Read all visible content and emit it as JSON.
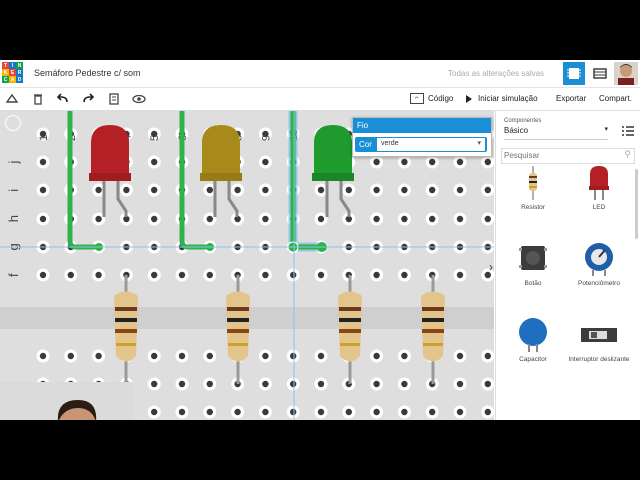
{
  "app": {
    "title": "Semáforo Pedestre c/ som",
    "saved_status": "Todas as alterações salvas"
  },
  "logo": {
    "letters": [
      "T",
      "I",
      "N",
      "K",
      "E",
      "R",
      "C",
      "A",
      "D"
    ],
    "colors": [
      "#e8453c",
      "#1478c8",
      "#12a14a",
      "#f7b500",
      "#e8453c",
      "#1478c8",
      "#12a14a",
      "#f7b500",
      "#1478c8"
    ]
  },
  "toolbar": {
    "code_label": "Código",
    "simulate_label": "Iniciar simulação",
    "export_label": "Exportar",
    "share_label": "Compart."
  },
  "breadboard": {
    "column_numbers": [
      "1",
      "2",
      "3",
      "4",
      "5",
      "6",
      "7",
      "8",
      "9",
      "10",
      "11"
    ],
    "row_letters": [
      "j",
      "i",
      "h",
      "g",
      "f"
    ]
  },
  "wire_popup": {
    "title": "Fio",
    "color_label": "Cor",
    "color_value": "verde"
  },
  "components_panel": {
    "header_label": "Componentes",
    "category": "Básico",
    "search_placeholder": "Pesquisar",
    "items": [
      {
        "label": "Resistor",
        "icon": "resistor-icon"
      },
      {
        "label": "LED",
        "icon": "led-icon"
      },
      {
        "label": "Botão",
        "icon": "pushbutton-icon"
      },
      {
        "label": "Potenciômetro",
        "icon": "potentiometer-icon"
      },
      {
        "label": "Capacitor",
        "icon": "capacitor-icon"
      },
      {
        "label": "Interruptor deslizante",
        "icon": "slide-switch-icon"
      }
    ]
  },
  "colors": {
    "accent": "#1a8fd6",
    "wire_green": "#2db34a",
    "led_red": "#b32025",
    "led_yellow": "#a88a1a",
    "led_green": "#1f9a2c"
  }
}
